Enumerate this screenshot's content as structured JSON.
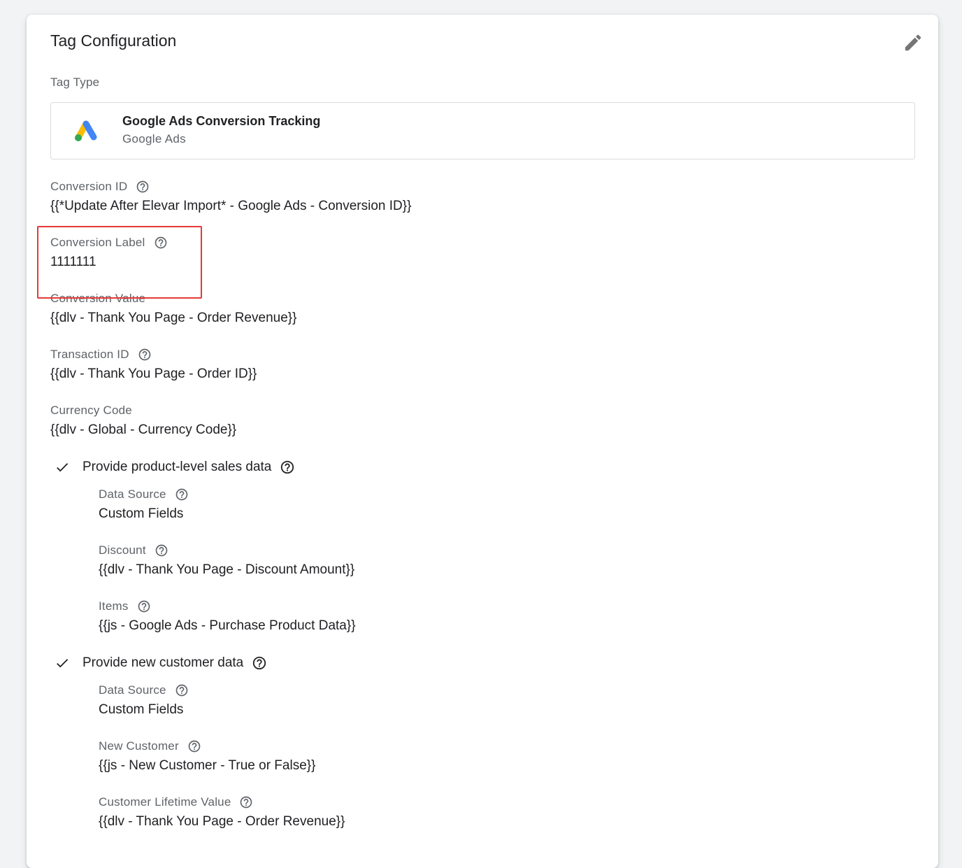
{
  "card": {
    "title": "Tag Configuration",
    "tag_type_label": "Tag Type",
    "tag_type": {
      "name": "Google Ads Conversion Tracking",
      "provider": "Google Ads",
      "logo_icon": "google-ads-logo"
    }
  },
  "fields": {
    "conversion_id": {
      "label": "Conversion ID",
      "value": "{{*Update After Elevar Import* - Google Ads - Conversion ID}}"
    },
    "conversion_label": {
      "label": "Conversion Label",
      "value": "1111111"
    },
    "conversion_value": {
      "label": "Conversion Value",
      "value": "{{dlv - Thank You Page - Order Revenue}}"
    },
    "transaction_id": {
      "label": "Transaction ID",
      "value": "{{dlv - Thank You Page - Order ID}}"
    },
    "currency_code": {
      "label": "Currency Code",
      "value": "{{dlv - Global - Currency Code}}"
    }
  },
  "product_sales": {
    "label": "Provide product-level sales data",
    "data_source": {
      "label": "Data Source",
      "value": "Custom Fields"
    },
    "discount": {
      "label": "Discount",
      "value": "{{dlv - Thank You Page - Discount Amount}}"
    },
    "items": {
      "label": "Items",
      "value": "{{js - Google Ads - Purchase Product Data}}"
    }
  },
  "new_customer": {
    "label": "Provide new customer data",
    "data_source": {
      "label": "Data Source",
      "value": "Custom Fields"
    },
    "new_customer": {
      "label": "New Customer",
      "value": "{{js - New Customer - True or False}}"
    },
    "lifetime_value": {
      "label": "Customer Lifetime Value",
      "value": "{{dlv - Thank You Page - Order Revenue}}"
    }
  },
  "colors": {
    "highlight": "#e53935",
    "label": "#5f6368",
    "text": "#202124",
    "ads_blue": "#4285f4",
    "ads_yellow": "#fbbc04",
    "ads_green": "#34a853"
  }
}
